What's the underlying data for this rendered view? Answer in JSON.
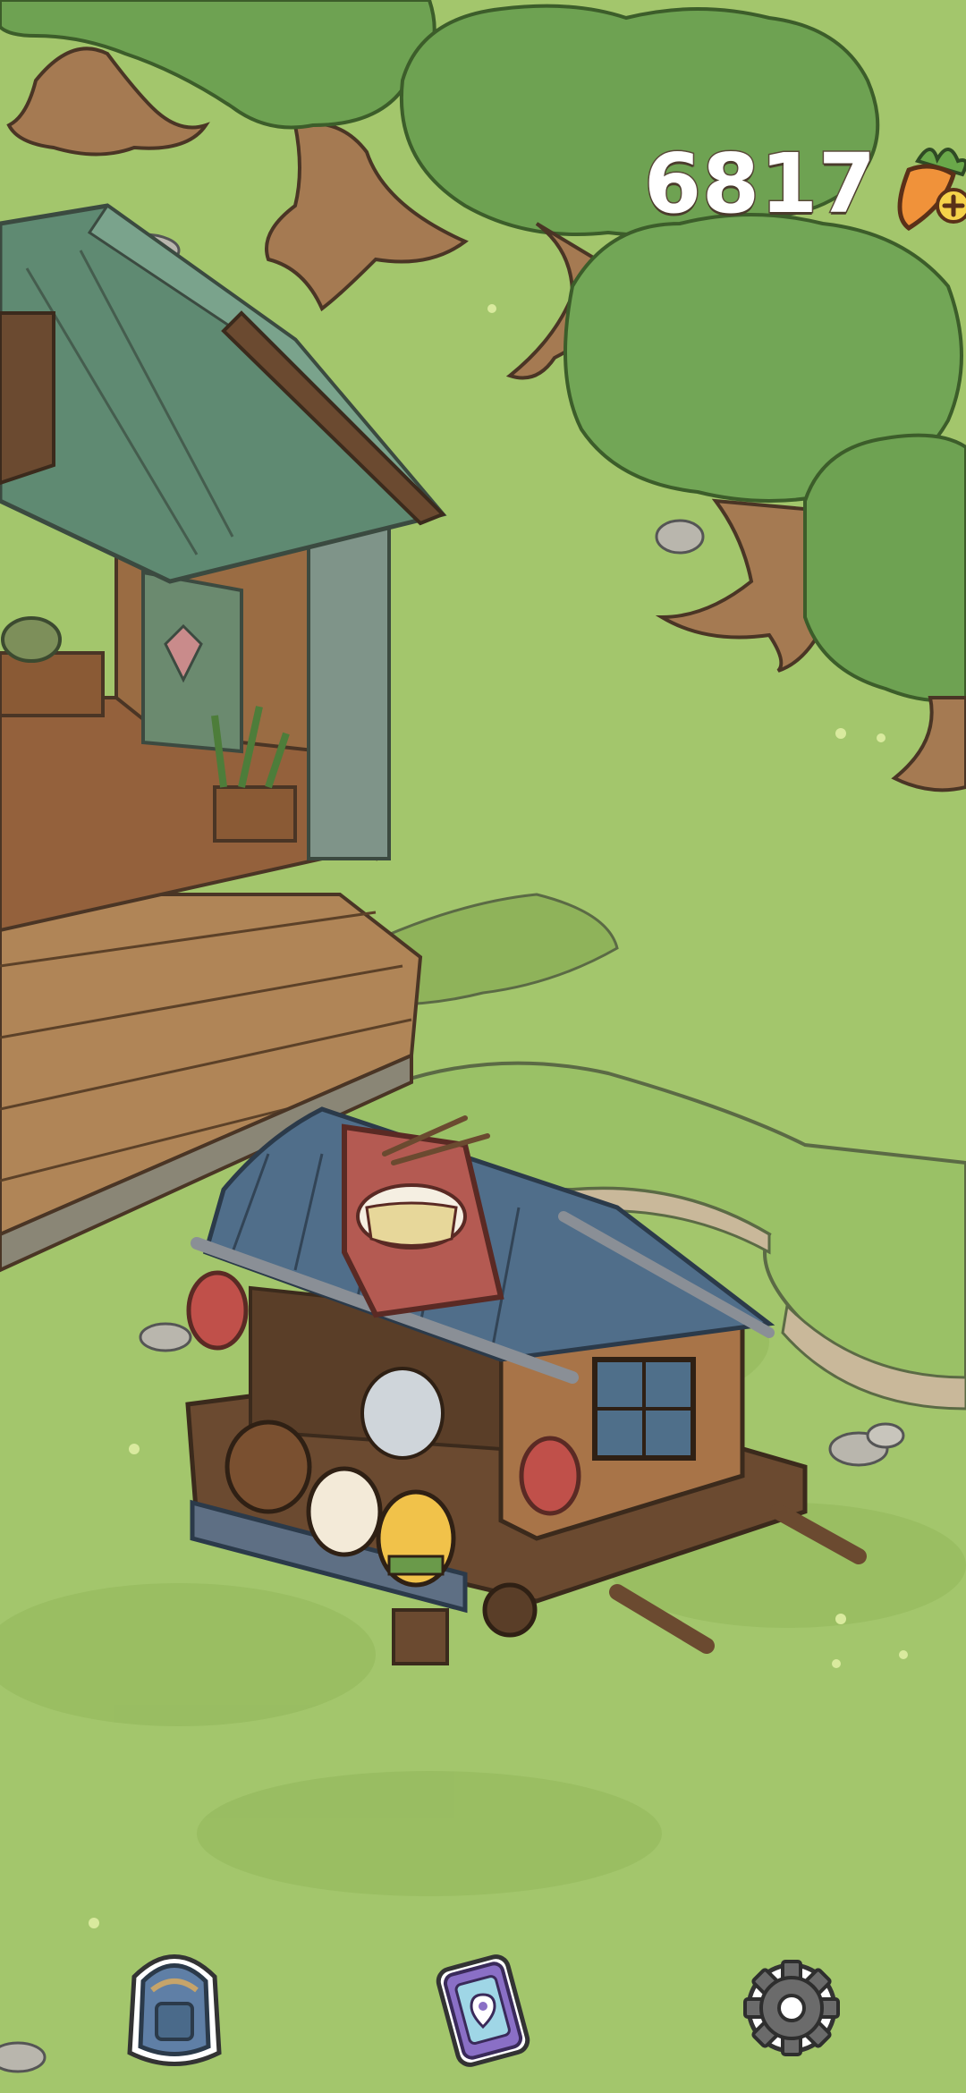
{
  "hud": {
    "carrot_count": "6817",
    "currency_icon": "carrot-icon",
    "add_icon": "plus-icon"
  },
  "toolbar": {
    "items": [
      {
        "id": "backpack",
        "icon": "backpack-icon"
      },
      {
        "id": "map",
        "icon": "map-pin-phone-icon"
      },
      {
        "id": "settings",
        "icon": "gear-icon"
      }
    ]
  },
  "colors": {
    "grass": "#a3c66c",
    "grass_dark": "#8fb35a",
    "foliage": "#6ea252",
    "foliage_dark": "#4d7d3a",
    "trunk": "#a57a52",
    "roof_green": "#5f8a72",
    "roof_blue": "#506e8a",
    "wood": "#8a5a35",
    "counter_text": "#ffffff",
    "lantern": "#c0504a"
  }
}
